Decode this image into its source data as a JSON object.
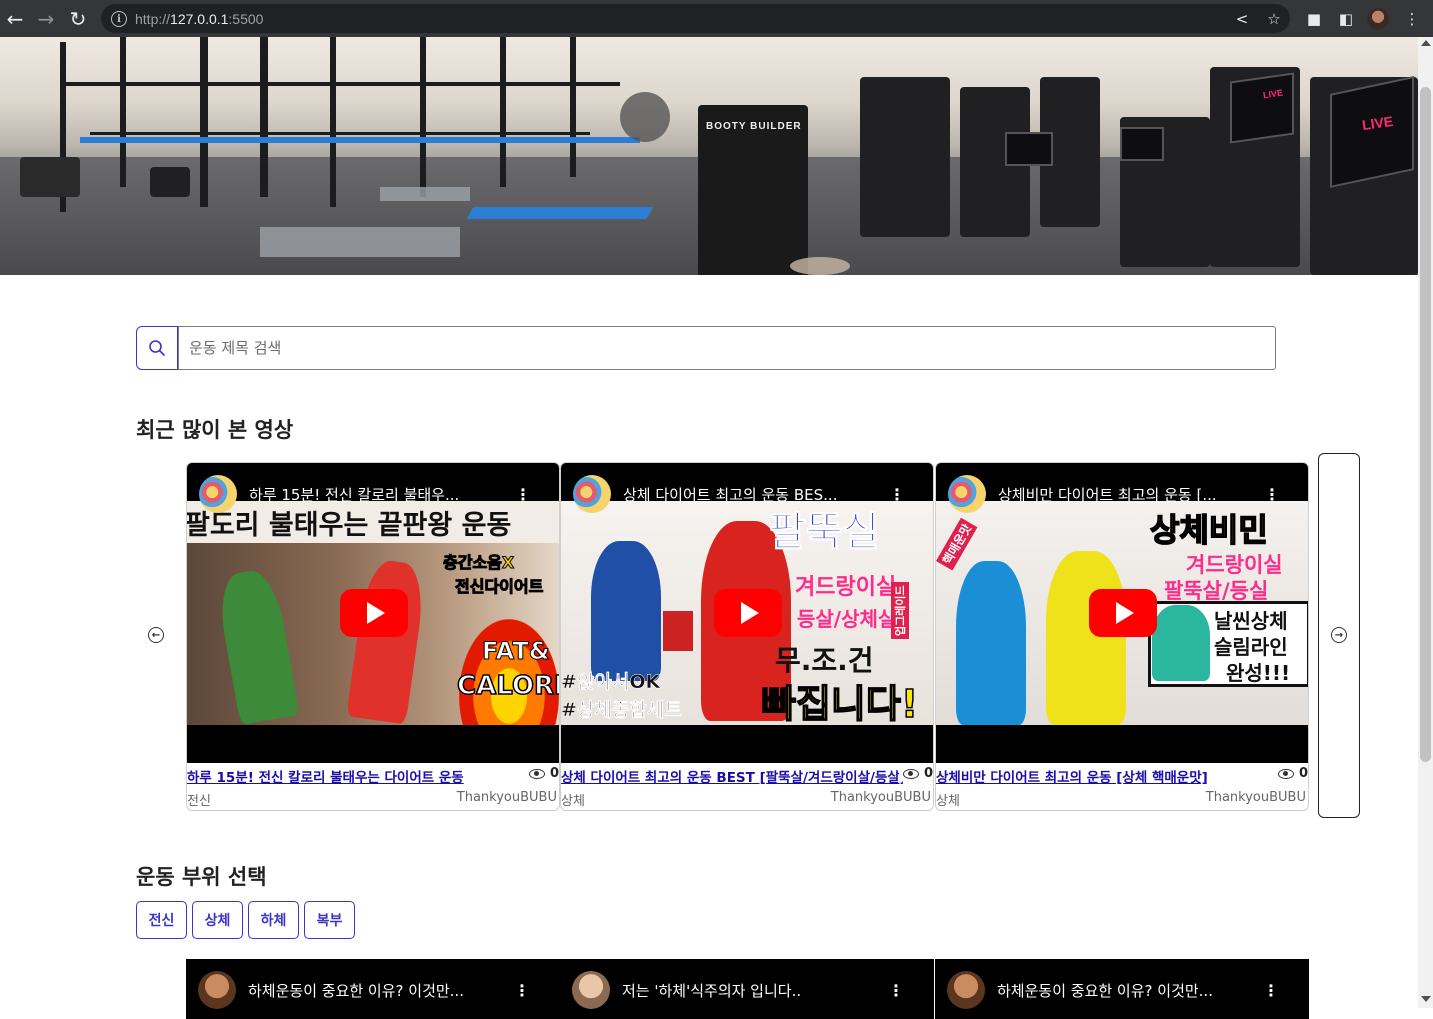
{
  "browser": {
    "url_prefix": "http://",
    "url_host": "127.0.0.1",
    "url_port": ":5500"
  },
  "search": {
    "placeholder": "운동 제목 검색",
    "value": ""
  },
  "popular": {
    "title": "최근 많이 본 영상",
    "videos": [
      {
        "player_title": "하루 15분! 전신 칼로리 불태우...",
        "title": "하루 15분! 전신 칼로리 불태우는 다이어트 운동",
        "views": "0",
        "category": "전신",
        "channel": "ThankyouBUBU",
        "thumb_text": [
          "팔도리 불태우는 끝판왕 운동",
          "층간소음X",
          "전신다이어트",
          "FAT&",
          "CALORIE"
        ]
      },
      {
        "player_title": "상체 다이어트 최고의 운동 BES...",
        "title": "상체 다이어트 최고의 운동 BEST [팔뚝살/겨드랑이살/등살]",
        "views": "0",
        "category": "상체",
        "channel": "ThankyouBUBU",
        "thumb_text": [
          "팔뚝실",
          "겨드랑이실",
          "등살/상체실",
          "무.조.건",
          "빠집니다!",
          "#앉아서OK",
          "#상체종합세트",
          "업그레이드"
        ]
      },
      {
        "player_title": "상체비만 다이어트 최고의 운동 [...",
        "title": "상체비만 다이어트 최고의 운동 [상체 핵매운맛]",
        "views": "0",
        "category": "상체",
        "channel": "ThankyouBUBU",
        "thumb_text": [
          "상체비민",
          "겨드랑이실",
          "팔뚝살/등실",
          "날씬상체",
          "슬림라인",
          "완성!!!",
          "핵매운맛"
        ]
      }
    ]
  },
  "body_parts": {
    "title": "운동 부위 선택",
    "options": [
      "전신",
      "상체",
      "하체",
      "복부"
    ]
  },
  "more_videos": [
    {
      "player_title": "하체운동이 중요한 이유? 이것만..."
    },
    {
      "player_title": "저는 '하체'식주의자 입니다.."
    },
    {
      "player_title": "하체운동이 중요한 이유? 이것만..."
    }
  ],
  "hero": {
    "machine_brand": "BOOTY BUILDER",
    "screen_label": "LIVE"
  },
  "colors": {
    "accent": "#3d34c9",
    "link": "#1a0dab",
    "youtube_red": "#ff0000"
  },
  "icons": {
    "back": "arrow-left-icon",
    "forward": "arrow-right-icon",
    "reload": "reload-icon",
    "search": "magnifier-icon",
    "prev": "circle-arrow-left-icon",
    "next": "circle-arrow-right-icon",
    "views": "eye-icon"
  }
}
